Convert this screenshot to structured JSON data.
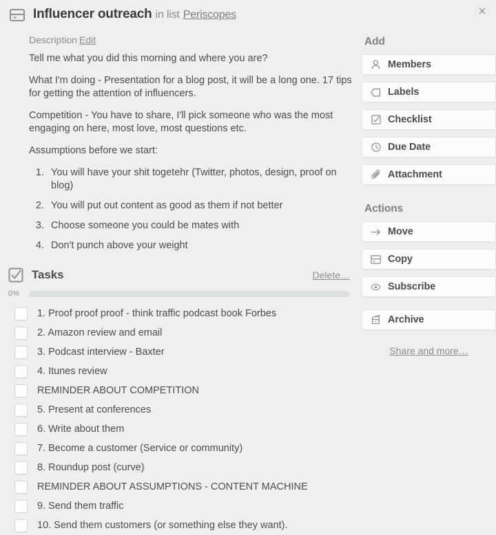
{
  "window": {
    "close_label": "×"
  },
  "header": {
    "card_icon": "card-icon",
    "title": "Influencer outreach",
    "in_list_label": "in list",
    "list_name": "Periscopes"
  },
  "description": {
    "heading": "Description",
    "edit_label": "Edit",
    "paragraphs": [
      "Tell me what you did this morning and where you are?",
      "What I'm doing - Presentation for a blog post, it will be a long one. 17 tips for getting the attention of influencers.",
      "Competition - You have to share, I'll pick someone who was the most engaging on here, most love, most questions etc.",
      "Assumptions before we start:"
    ],
    "numbered_items": [
      "You will have your shit togetehr (Twitter, photos, design, proof on blog)",
      "You will put out content as good as them if not better",
      "Choose someone you could be mates with",
      "Don't punch above your weight"
    ]
  },
  "tasks": {
    "icon": "checkbox-icon",
    "title": "Tasks",
    "delete_label": "Delete…",
    "progress_percent_label": "0%",
    "progress_percent": 0,
    "items": [
      {
        "label": "1. Proof proof proof - think traffic podcast book Forbes",
        "checked": false
      },
      {
        "label": "2. Amazon review and email",
        "checked": false
      },
      {
        "label": "3. Podcast interview - Baxter",
        "checked": false
      },
      {
        "label": "4. Itunes review",
        "checked": false
      },
      {
        "label": "REMINDER ABOUT COMPETITION",
        "checked": false
      },
      {
        "label": "5. Present at conferences",
        "checked": false
      },
      {
        "label": "6. Write about them",
        "checked": false
      },
      {
        "label": "7. Become a customer (Service or community)",
        "checked": false
      },
      {
        "label": "8. Roundup post (curve)",
        "checked": false
      },
      {
        "label": "REMINDER ABOUT ASSUMPTIONS - CONTENT MACHINE",
        "checked": false
      },
      {
        "label": "9. Send them traffic",
        "checked": false
      },
      {
        "label": "10. Send them customers (or something else they want).",
        "checked": false
      }
    ]
  },
  "sidebar": {
    "add_title": "Add",
    "add_buttons": [
      {
        "label": "Members",
        "icon": "person-icon"
      },
      {
        "label": "Labels",
        "icon": "tag-icon"
      },
      {
        "label": "Checklist",
        "icon": "checkbox-icon"
      },
      {
        "label": "Due Date",
        "icon": "clock-icon"
      },
      {
        "label": "Attachment",
        "icon": "paperclip-icon"
      }
    ],
    "actions_title": "Actions",
    "action_buttons": [
      {
        "label": "Move",
        "icon": "arrow-right-icon"
      },
      {
        "label": "Copy",
        "icon": "card-icon"
      },
      {
        "label": "Subscribe",
        "icon": "eye-icon"
      }
    ],
    "archive_button": {
      "label": "Archive",
      "icon": "archive-icon"
    },
    "share_label": "Share and more…"
  },
  "colors": {
    "page_background": "#edeff0",
    "text": "#4d4d4d",
    "muted_text": "#8a8d8f",
    "button_background": "#fcfcfc",
    "progress_track": "#dcdfe0"
  }
}
